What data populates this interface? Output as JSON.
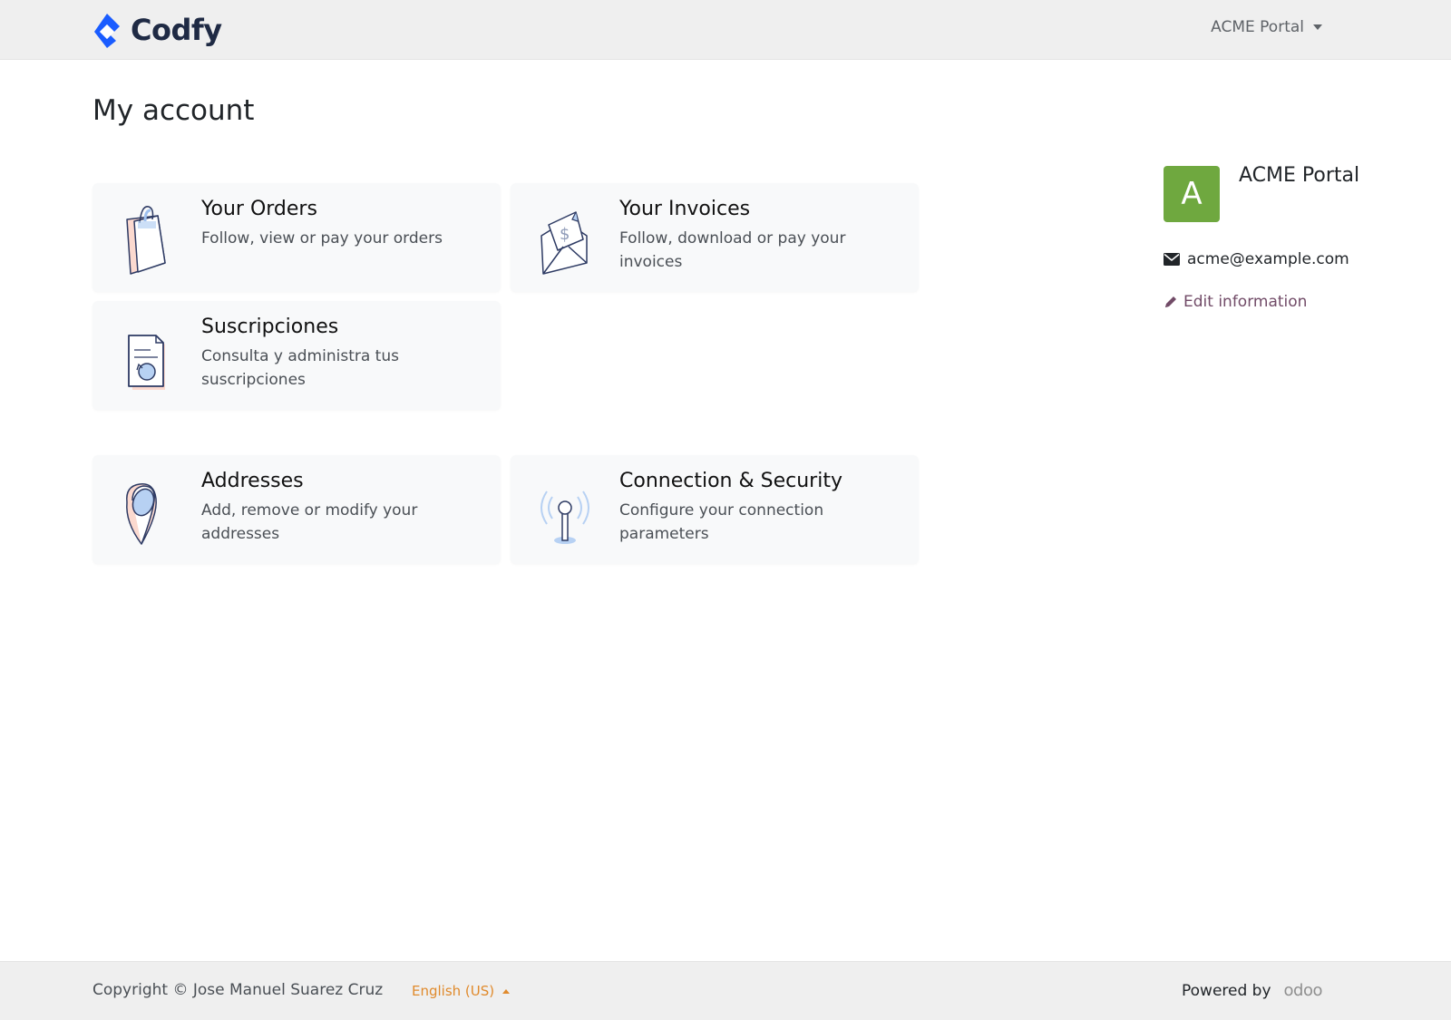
{
  "header": {
    "brand_name": "Codfy",
    "user_menu_label": "ACME Portal"
  },
  "main": {
    "title": "My account",
    "cards": [
      {
        "title": "Your Orders",
        "description": "Follow, view or pay your orders",
        "icon": "shopping-bag-icon"
      },
      {
        "title": "Your Invoices",
        "description": "Follow, download or pay your invoices",
        "icon": "invoice-envelope-icon"
      },
      {
        "title": "Suscripciones",
        "description": "Consulta y administra tus suscripciones",
        "icon": "subscription-document-icon"
      },
      {
        "title": "Addresses",
        "description": "Add, remove or modify your addresses",
        "icon": "map-pin-icon"
      },
      {
        "title": "Connection & Security",
        "description": "Configure your connection parameters",
        "icon": "antenna-signal-icon"
      }
    ]
  },
  "profile": {
    "avatar_letter": "A",
    "avatar_color": "#6fa83f",
    "name": "ACME Portal",
    "email": "acme@example.com",
    "edit_label": "Edit information"
  },
  "footer": {
    "copyright": "Copyright © Jose Manuel Suarez Cruz",
    "language": "English (US)",
    "powered_by": "Powered by",
    "powered_logo": "odoo"
  },
  "colors": {
    "accent_link": "#714b67",
    "language_link": "#e08a2c",
    "brand_blue": "#1a5cff"
  }
}
